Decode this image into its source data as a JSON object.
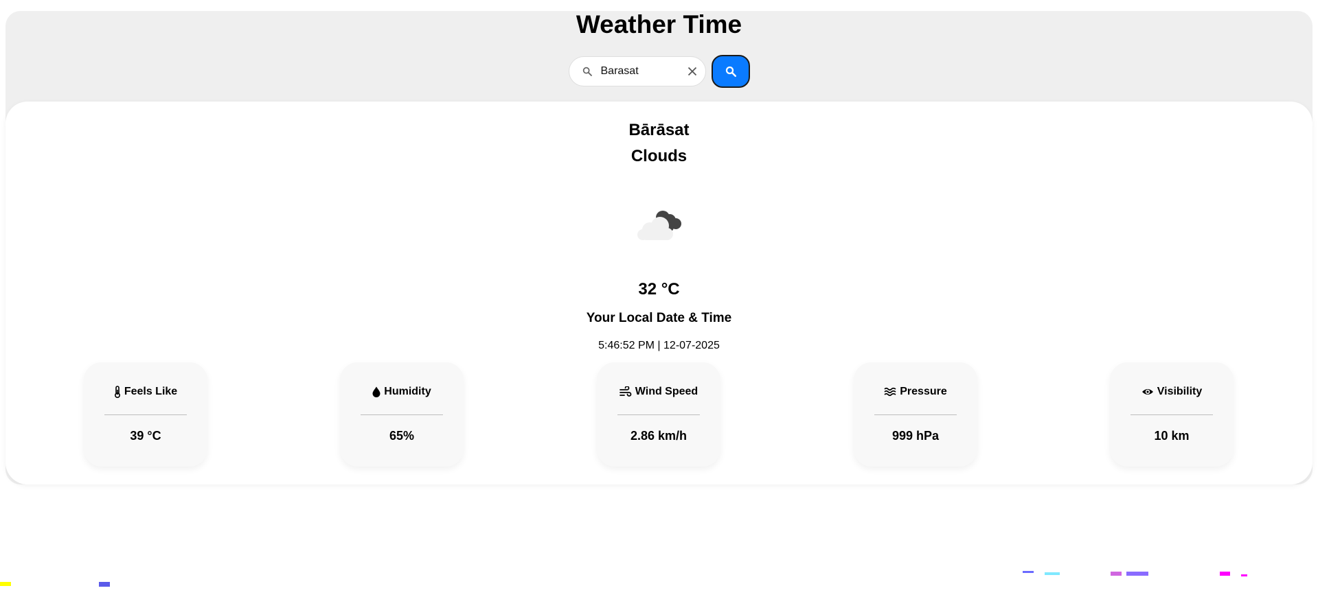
{
  "app": {
    "title": "Weather Time"
  },
  "search": {
    "value": "Barasat",
    "icon": "search-icon",
    "clear_icon": "close-icon",
    "button_icon": "search-icon"
  },
  "weather": {
    "city": "Bārāsat",
    "condition": "Clouds",
    "icon": "cloud-icon",
    "temperature": "32 °C",
    "datetime_label": "Your Local Date & Time",
    "datetime_value": "5:46:52 PM | 12-07-2025"
  },
  "stats": [
    {
      "label": "Feels Like",
      "value": "39 °C",
      "icon": "thermometer-icon"
    },
    {
      "label": "Humidity",
      "value": "65%",
      "icon": "droplet-icon"
    },
    {
      "label": "Wind Speed",
      "value": "2.86 km/h",
      "icon": "wind-icon"
    },
    {
      "label": "Pressure",
      "value": "999 hPa",
      "icon": "water-waves-icon"
    },
    {
      "label": "Visibility",
      "value": "10 km",
      "icon": "eye-icon"
    }
  ],
  "colors": {
    "accent": "#0a7bff",
    "page_bg": "#efefef",
    "card_bg": "#ffffff",
    "stat_bg": "#f8f8f8"
  }
}
